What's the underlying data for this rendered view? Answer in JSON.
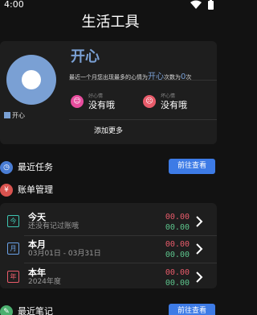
{
  "status_bar": {
    "time": "4:00",
    "icons": [
      "wifi-icon",
      "battery-icon"
    ]
  },
  "page": {
    "title": "生活工具"
  },
  "mood": {
    "dominant_mood": "开心",
    "legend_label": "开心",
    "summary_prefix": "最近一个月您出现最多的心情为",
    "summary_mood": "开心",
    "summary_mid": "次数为",
    "summary_count": "0",
    "summary_suffix": "次",
    "good_label": "好心情",
    "good_value": "没有哦",
    "bad_label": "坏心情",
    "bad_value": "没有哦",
    "add_more": "添加更多",
    "colors": {
      "accent": "#7aa0d4",
      "good": "#e84d9e",
      "bad": "#e85b6a"
    }
  },
  "tasks": {
    "title": "最近任务",
    "button": "前往查看",
    "icon": "clock-icon"
  },
  "bills": {
    "title": "账单管理",
    "icon": "money-icon",
    "rows": [
      {
        "icon_char": "今",
        "title": "今天",
        "subtitle": "还没有记过账哦",
        "income": "00.00",
        "expense": "00.00"
      },
      {
        "icon_char": "月",
        "title": "本月",
        "subtitle": "03月01日 - 03月31日",
        "income": "00.00",
        "expense": "00.00"
      },
      {
        "icon_char": "年",
        "title": "本年",
        "subtitle": "2024年度",
        "income": "00.00",
        "expense": "00.00"
      }
    ],
    "colors": {
      "income": "#e85b6a",
      "expense": "#5cc48c"
    }
  },
  "notes": {
    "title": "最近笔记",
    "button": "前往查看",
    "icon": "note-icon"
  }
}
